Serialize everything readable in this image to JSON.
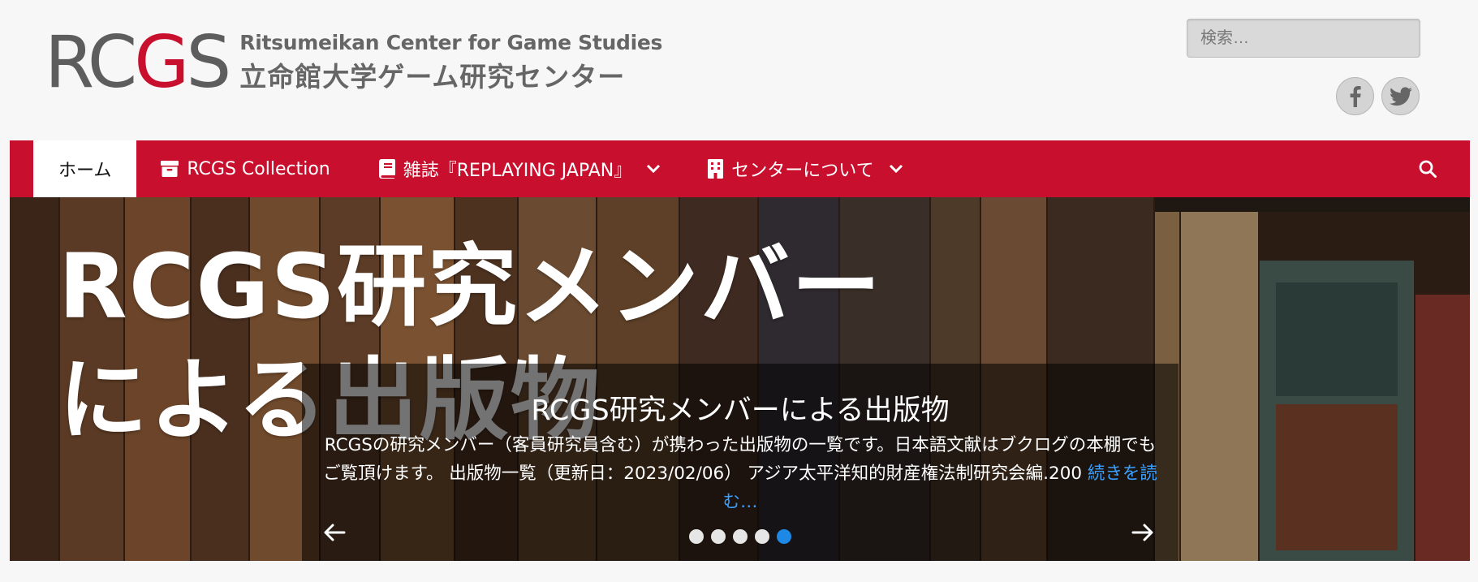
{
  "header": {
    "logo_mark_left": "RC",
    "logo_mark_g": "G",
    "logo_mark_right": "S",
    "logo_en": "Ritsumeikan Center for Game Studies",
    "logo_ja": "立命館大学ゲーム研究センター",
    "search_placeholder": "検索…",
    "social": [
      {
        "name": "facebook",
        "icon": "facebook-icon"
      },
      {
        "name": "twitter",
        "icon": "twitter-icon"
      }
    ]
  },
  "nav": {
    "items": [
      {
        "label": "ホーム",
        "active": true
      },
      {
        "label": "RCGS Collection",
        "icon": "archive-box-icon"
      },
      {
        "label": "雑誌『REPLAYING JAPAN』",
        "icon": "book-icon",
        "dropdown": true
      },
      {
        "label": "センターについて",
        "icon": "building-icon",
        "dropdown": true
      }
    ],
    "search_icon": "search-icon"
  },
  "slider": {
    "image_title_line1": "RCGS研究メンバー",
    "image_title_line2": "による出版物",
    "caption_title": "RCGS研究メンバーによる出版物",
    "caption_body": "RCGSの研究メンバー（客員研究員含む）が携わった出版物の一覧です。日本語文献はブクログの本棚でもご覧頂けます。 出版物一覧（更新日：2023/02/06） アジア太平洋知的財産権法制研究会編.200 ",
    "read_more": "続きを読む…",
    "active_dot": 5,
    "dot_count": 5
  },
  "colors": {
    "brand_red": "#c8102e",
    "link_blue": "#3aa0ff",
    "active_dot": "#1e88e5"
  }
}
